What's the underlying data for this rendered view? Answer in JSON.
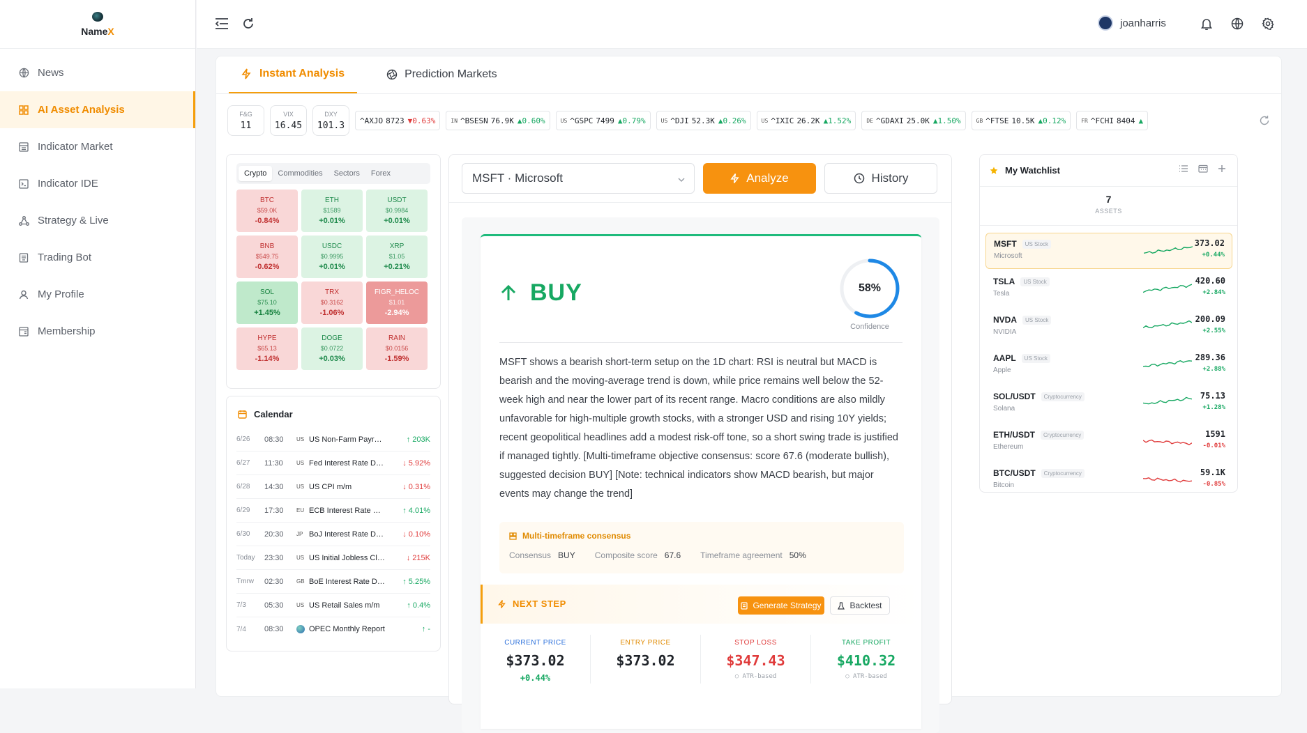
{
  "app": {
    "name_main": "Name",
    "name_accent": "X"
  },
  "sidebar": {
    "items": [
      {
        "label": "News",
        "icon": "globe-icon",
        "active": false
      },
      {
        "label": "AI Asset Analysis",
        "icon": "grid-icon",
        "active": true
      },
      {
        "label": "Indicator Market",
        "icon": "store-icon",
        "active": false
      },
      {
        "label": "Indicator IDE",
        "icon": "code-icon",
        "active": false
      },
      {
        "label": "Strategy & Live",
        "icon": "nodes-icon",
        "active": false
      },
      {
        "label": "Trading Bot",
        "icon": "bot-icon",
        "active": false
      },
      {
        "label": "My Profile",
        "icon": "user-icon",
        "active": false
      },
      {
        "label": "Membership",
        "icon": "card-icon",
        "active": false
      }
    ]
  },
  "header": {
    "username": "joanharris"
  },
  "tabs": [
    {
      "label": "Instant Analysis",
      "active": true
    },
    {
      "label": "Prediction Markets",
      "active": false
    }
  ],
  "ticker": {
    "stats": [
      {
        "label": "F&G",
        "value": "11"
      },
      {
        "label": "VIX",
        "value": "16.45"
      },
      {
        "label": "DXY",
        "value": "101.3"
      }
    ],
    "quotes": [
      {
        "cc": "",
        "sym": "^AXJO",
        "price": "8723",
        "chg": "▼0.63%",
        "dir": "down"
      },
      {
        "cc": "IN",
        "sym": "^BSESN",
        "price": "76.9K",
        "chg": "▲0.60%",
        "dir": "up"
      },
      {
        "cc": "US",
        "sym": "^GSPC",
        "price": "7499",
        "chg": "▲0.79%",
        "dir": "up"
      },
      {
        "cc": "US",
        "sym": "^DJI",
        "price": "52.3K",
        "chg": "▲0.26%",
        "dir": "up"
      },
      {
        "cc": "US",
        "sym": "^IXIC",
        "price": "26.2K",
        "chg": "▲1.52%",
        "dir": "up"
      },
      {
        "cc": "DE",
        "sym": "^GDAXI",
        "price": "25.0K",
        "chg": "▲1.50%",
        "dir": "up"
      },
      {
        "cc": "GB",
        "sym": "^FTSE",
        "price": "10.5K",
        "chg": "▲0.12%",
        "dir": "up"
      },
      {
        "cc": "FR",
        "sym": "^FCHI",
        "price": "8404",
        "chg": "▲",
        "dir": "up"
      }
    ]
  },
  "market_tabs": [
    "Crypto",
    "Commodities",
    "Sectors",
    "Forex"
  ],
  "heatmap": [
    {
      "sym": "BTC",
      "price": "$59.0K",
      "chg": "-0.84%",
      "tone": "h-lr"
    },
    {
      "sym": "ETH",
      "price": "$1589",
      "chg": "+0.01%",
      "tone": "h-lg"
    },
    {
      "sym": "USDT",
      "price": "$0.9984",
      "chg": "+0.01%",
      "tone": "h-lg"
    },
    {
      "sym": "BNB",
      "price": "$549.75",
      "chg": "-0.62%",
      "tone": "h-lr"
    },
    {
      "sym": "USDC",
      "price": "$0.9995",
      "chg": "+0.01%",
      "tone": "h-lg"
    },
    {
      "sym": "XRP",
      "price": "$1.05",
      "chg": "+0.21%",
      "tone": "h-lg"
    },
    {
      "sym": "SOL",
      "price": "$75.10",
      "chg": "+1.45%",
      "tone": "h-g"
    },
    {
      "sym": "TRX",
      "price": "$0.3162",
      "chg": "-1.06%",
      "tone": "h-lr"
    },
    {
      "sym": "FIGR_HELOC",
      "price": "$1.01",
      "chg": "-2.94%",
      "tone": "h-r"
    },
    {
      "sym": "HYPE",
      "price": "$65.13",
      "chg": "-1.14%",
      "tone": "h-lr"
    },
    {
      "sym": "DOGE",
      "price": "$0.0722",
      "chg": "+0.03%",
      "tone": "h-lg"
    },
    {
      "sym": "RAIN",
      "price": "$0.0156",
      "chg": "-1.59%",
      "tone": "h-lr"
    }
  ],
  "calendar": {
    "title": "Calendar",
    "rows": [
      {
        "date": "6/26",
        "time": "08:30",
        "cc": "US",
        "event": "US Non-Farm Payrolls",
        "val": "↑ 203K",
        "dir": "up"
      },
      {
        "date": "6/27",
        "time": "11:30",
        "cc": "US",
        "event": "Fed Interest Rate De...",
        "val": "↓ 5.92%",
        "dir": "down"
      },
      {
        "date": "6/28",
        "time": "14:30",
        "cc": "US",
        "event": "US CPI m/m",
        "val": "↓ 0.31%",
        "dir": "down"
      },
      {
        "date": "6/29",
        "time": "17:30",
        "cc": "EU",
        "event": "ECB Interest Rate De...",
        "val": "↑ 4.01%",
        "dir": "up"
      },
      {
        "date": "6/30",
        "time": "20:30",
        "cc": "JP",
        "event": "BoJ Interest Rate Dec...",
        "val": "↓ 0.10%",
        "dir": "down"
      },
      {
        "date": "Today",
        "time": "23:30",
        "cc": "US",
        "event": "US Initial Jobless Claims",
        "val": "↓ 215K",
        "dir": "down"
      },
      {
        "date": "Tmrw",
        "time": "02:30",
        "cc": "GB",
        "event": "BoE Interest Rate De...",
        "val": "↑ 5.25%",
        "dir": "up"
      },
      {
        "date": "7/3",
        "time": "05:30",
        "cc": "US",
        "event": "US Retail Sales m/m",
        "val": "↑ 0.4%",
        "dir": "up"
      },
      {
        "date": "7/4",
        "time": "08:30",
        "cc": "",
        "event": "OPEC Monthly Report",
        "val": "↑ -",
        "dir": "up"
      }
    ]
  },
  "analysis": {
    "selected_asset": "MSFT · Microsoft",
    "analyze_label": "Analyze",
    "history_label": "History",
    "signal": "BUY",
    "confidence": "58%",
    "confidence_value": 0.58,
    "confidence_label": "Confidence",
    "text": "MSFT shows a bearish short-term setup on the 1D chart: RSI is neutral but MACD is bearish and the moving-average trend is down, while price remains well below the 52-week high and near the lower part of its recent range. Macro conditions are also mildly unfavorable for high-multiple growth stocks, with a stronger USD and rising 10Y yields; recent geopolitical headlines add a modest risk-off tone, so a short swing trade is justified if managed tightly. [Multi-timeframe objective consensus: score 67.6 (moderate bullish), suggested decision BUY] [Note: technical indicators show MACD bearish, but major events may change the trend]",
    "mtf_title": "Multi-timeframe consensus",
    "mtf": [
      {
        "k": "Consensus",
        "v": "BUY"
      },
      {
        "k": "Composite score",
        "v": "67.6"
      },
      {
        "k": "Timeframe agreement",
        "v": "50%"
      }
    ],
    "next_step_title": "NEXT STEP",
    "generate_label": "Generate Strategy",
    "backtest_label": "Backtest",
    "prices": [
      {
        "label": "CURRENT PRICE",
        "value": "$373.02",
        "sub": "+0.44%",
        "color": "#2a6fdb",
        "vcolor": "#1f2329",
        "subcolor": "#17a862"
      },
      {
        "label": "ENTRY PRICE",
        "value": "$373.02",
        "sub": "",
        "color": "#e08a00",
        "vcolor": "#1f2329",
        "subcolor": "#9aa0a8"
      },
      {
        "label": "STOP LOSS",
        "value": "$347.43",
        "sub": "○ ATR-based",
        "color": "#e03b3b",
        "vcolor": "#e03b3b",
        "subcolor": "#9aa0a8"
      },
      {
        "label": "TAKE PROFIT",
        "value": "$410.32",
        "sub": "○ ATR-based",
        "color": "#17a862",
        "vcolor": "#17a862",
        "subcolor": "#9aa0a8"
      }
    ]
  },
  "watchlist": {
    "title": "My Watchlist",
    "count": "7",
    "count_label": "ASSETS",
    "items": [
      {
        "sym": "MSFT",
        "type": "US Stock",
        "name": "Microsoft",
        "price": "373.02",
        "chg": "+0.44%",
        "dir": "up",
        "selected": true
      },
      {
        "sym": "TSLA",
        "type": "US Stock",
        "name": "Tesla",
        "price": "420.60",
        "chg": "+2.84%",
        "dir": "up",
        "selected": false
      },
      {
        "sym": "NVDA",
        "type": "US Stock",
        "name": "NVIDIA",
        "price": "200.09",
        "chg": "+2.55%",
        "dir": "up",
        "selected": false
      },
      {
        "sym": "AAPL",
        "type": "US Stock",
        "name": "Apple",
        "price": "289.36",
        "chg": "+2.88%",
        "dir": "up",
        "selected": false
      },
      {
        "sym": "SOL/USDT",
        "type": "Cryptocurrency",
        "name": "Solana",
        "price": "75.13",
        "chg": "+1.28%",
        "dir": "up",
        "selected": false
      },
      {
        "sym": "ETH/USDT",
        "type": "Cryptocurrency",
        "name": "Ethereum",
        "price": "1591",
        "chg": "-0.01%",
        "dir": "down",
        "selected": false
      },
      {
        "sym": "BTC/USDT",
        "type": "Cryptocurrency",
        "name": "Bitcoin",
        "price": "59.1K",
        "chg": "-0.85%",
        "dir": "down",
        "selected": false
      }
    ]
  },
  "colors": {
    "accent": "#f59e0b",
    "up": "#17a862",
    "down": "#e03b3b",
    "gauge": "#1e88e5"
  }
}
